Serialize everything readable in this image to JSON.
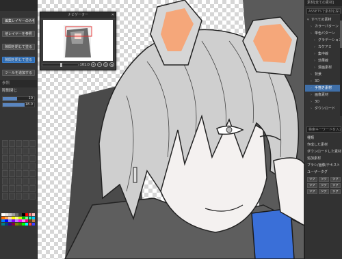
{
  "left_panel": {
    "texts": [
      "編集レイヤーのみ参照",
      "他レイヤーを参照",
      "隙間を閉じて塗る",
      "ツールを追加する"
    ],
    "settings_label": "参照",
    "slider_label": "隙間閉じ",
    "slider_value": "10",
    "slider_fill": 0.45,
    "size_value": "18.0",
    "palette": [
      "#ffffff",
      "#e6e6e6",
      "#c8c8c8",
      "#a0a0a0",
      "#6e6e6e",
      "#3c3c3c",
      "#000000",
      "#ff0000",
      "#ff8080",
      "#ffc0c0",
      "#ff6a00",
      "#ffa64d",
      "#ffd9b3",
      "#ffff00",
      "#ffff80",
      "#c8ff00",
      "#00c800",
      "#80ff80",
      "#00ffc8",
      "#00c8ff",
      "#0080ff",
      "#0000ff",
      "#8080ff",
      "#8000ff",
      "#c080ff",
      "#ff00ff",
      "#ff80ff",
      "#ff0080",
      "#804000",
      "#c08040",
      "#008080",
      "#004080",
      "#400080",
      "#800040",
      "#808000",
      "#408000",
      "#00ff00",
      "#00ffff",
      "#ff4040",
      "#4040ff"
    ]
  },
  "navigator": {
    "title": "ナビゲーター",
    "zoom": "101.0",
    "angle": "0.0"
  },
  "right_panel": {
    "title": "素材[全ての素材]",
    "search_placeholder": "ASSETSで素材を探す",
    "tree": [
      {
        "label": "すべての素材",
        "depth": 0
      },
      {
        "label": "カラーパターン",
        "depth": 1
      },
      {
        "label": "単色パターン",
        "depth": 1
      },
      {
        "label": "グラデーション",
        "depth": 2
      },
      {
        "label": "カケアミ",
        "depth": 2
      },
      {
        "label": "集中線",
        "depth": 2
      },
      {
        "label": "効果線",
        "depth": 2
      },
      {
        "label": "漫画素材",
        "depth": 2
      },
      {
        "label": "背景",
        "depth": 1
      },
      {
        "label": "3D",
        "depth": 1
      },
      {
        "label": "手描き素材",
        "depth": 1,
        "selected": true
      },
      {
        "label": "画像素材",
        "depth": 1
      },
      {
        "label": "3D",
        "depth": 1
      },
      {
        "label": "ダウンロード",
        "depth": 1
      }
    ],
    "lower_search": "検索キーワードを入力",
    "lower_items": [
      "種類",
      "作成した素材",
      "ダウンロードした素材",
      "追加素材",
      "ブラシ/画像/テキスト",
      "ユーザータグ"
    ],
    "tags": [
      "タグ",
      "タグ",
      "タグ",
      "タグ",
      "タグ",
      "タグ",
      "タグ",
      "タグ",
      "タグ"
    ]
  },
  "colors": {
    "accent_blue": "#3f6fa8",
    "ear_orange": "#f5a77a",
    "hair_gray": "#cfcfcf",
    "jacket_blue": "#3a6fd8"
  }
}
